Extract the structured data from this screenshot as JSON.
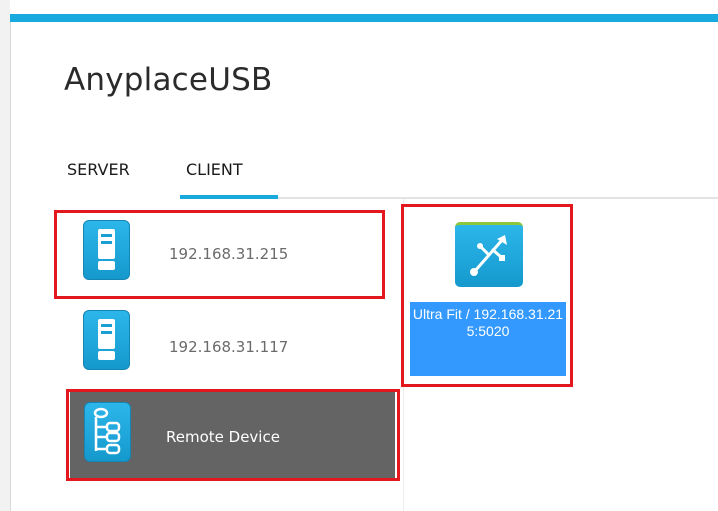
{
  "app": {
    "title": "AnyplaceUSB"
  },
  "tabs": [
    {
      "label": "SERVER",
      "selected": false
    },
    {
      "label": "CLIENT",
      "selected": true
    }
  ],
  "servers": [
    {
      "label": "192.168.31.215",
      "icon": "server-icon"
    },
    {
      "label": "192.168.31.117",
      "icon": "server-icon"
    }
  ],
  "remote_device": {
    "label": "Remote Device",
    "icon": "device-tree-icon"
  },
  "devices": [
    {
      "label": "Ultra Fit / 192.168.31.215:5020",
      "icon": "usb-icon"
    }
  ],
  "colors": {
    "accent": "#18a9df",
    "selection": "#3399ff",
    "selected_row": "#646464",
    "highlight": "#e3181f"
  }
}
